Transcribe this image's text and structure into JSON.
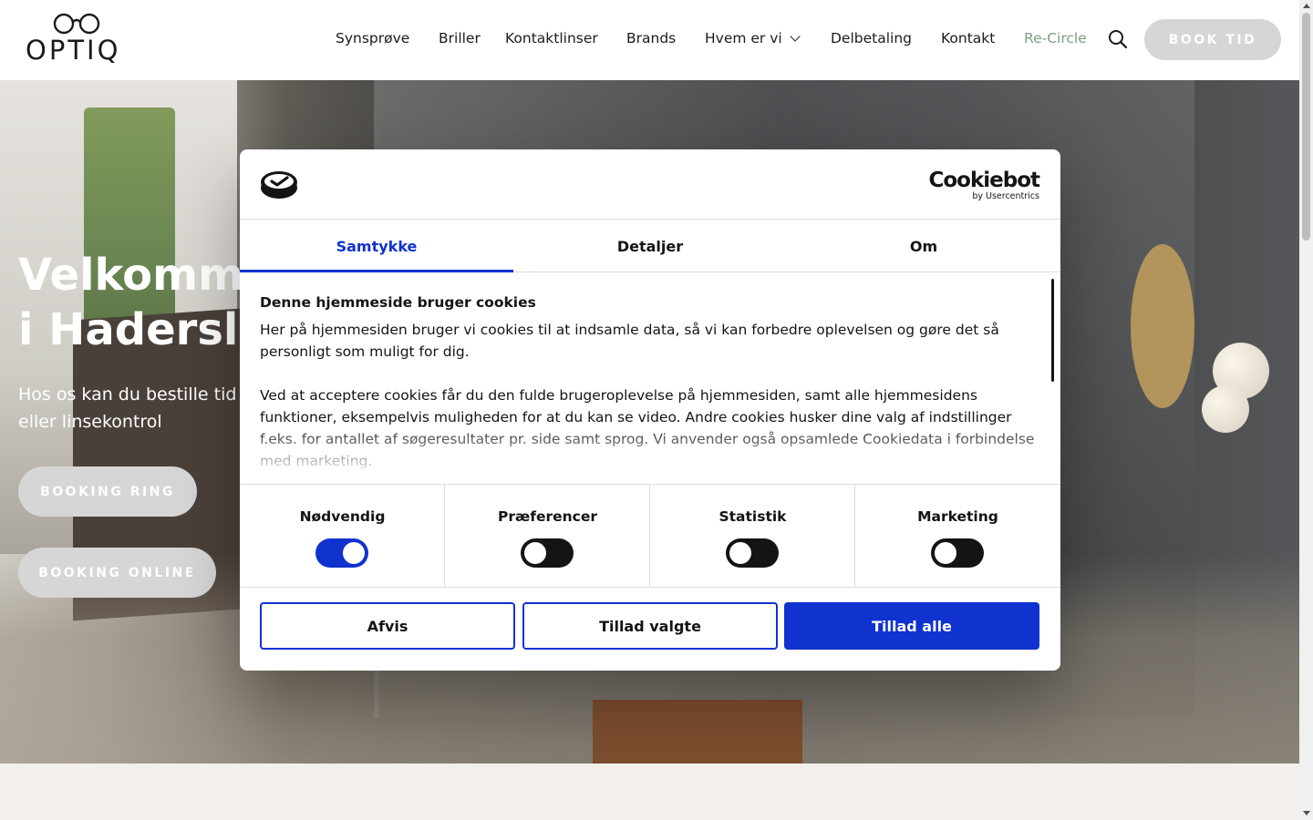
{
  "header": {
    "logo_text": "OPTIQ",
    "nav": [
      {
        "label": "Synsprøve"
      },
      {
        "label": "Briller"
      },
      {
        "label": "Kontaktlinser"
      },
      {
        "label": "Brands"
      },
      {
        "label": "Hvem er vi"
      },
      {
        "label": "Delbetaling"
      },
      {
        "label": "Kontakt"
      },
      {
        "label": "Re-Circle"
      }
    ],
    "book_label": "BOOK TID",
    "search_icon": "search-icon"
  },
  "hero": {
    "title": "Velkommen\ni Haderslev",
    "subtitle": "Hos os kan du bestille tid\neller linsekontrol",
    "booking_ring": "BOOKING RING",
    "booking_online": "BOOKING ONLINE"
  },
  "consent": {
    "brand_name": "Cookiebot",
    "brand_by": "by Usercentrics",
    "tabs": [
      "Samtykke",
      "Detaljer",
      "Om"
    ],
    "active_tab": "Samtykke",
    "heading": "Denne hjemmeside bruger cookies",
    "paragraph1": "Her på hjemmesiden bruger vi cookies til at indsamle data, så vi kan forbedre oplevelsen og gøre det så personligt som muligt for dig.",
    "paragraph2": "Ved at acceptere cookies får du den fulde brugeroplevelse på hjemmesiden, samt alle hjemmesidens funktioner, eksempelvis muligheden for at du kan se video. Andre cookies husker dine valg af indstillinger f.eks. for antallet af søgeresultater pr. side samt sprog. Vi anvender også opsamlede Cookiedata i forbindelse med marketing.",
    "toggles": [
      {
        "label": "Nødvendig",
        "on": true
      },
      {
        "label": "Præferencer",
        "on": false
      },
      {
        "label": "Statistik",
        "on": false
      },
      {
        "label": "Marketing",
        "on": false
      }
    ],
    "buttons": {
      "deny": "Afvis",
      "allow_selected": "Tillad valgte",
      "allow_all": "Tillad alle"
    }
  },
  "colors": {
    "accent": "#1032cf",
    "recircle": "#7aa07e",
    "button_grey": "#d6d6d6"
  }
}
